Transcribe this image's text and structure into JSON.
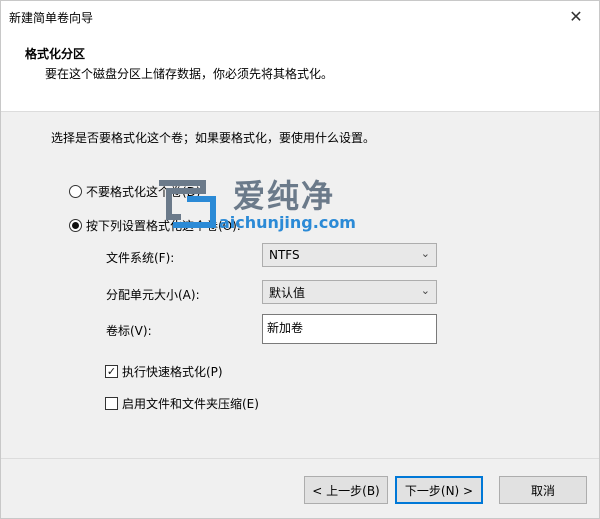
{
  "window": {
    "title": "新建简单卷向导",
    "close_symbol": "✕"
  },
  "header": {
    "title": "格式化分区",
    "subtitle": "要在这个磁盘分区上储存数据，你必须先将其格式化。"
  },
  "main": {
    "prompt": "选择是否要格式化这个卷；如果要格式化，要使用什么设置。",
    "options": [
      {
        "label": "不要格式化这个卷(D)",
        "checked": false
      },
      {
        "label": "按下列设置格式化这个卷(O):",
        "checked": true
      }
    ],
    "fields": {
      "filesystem": {
        "label": "文件系统(F):",
        "value": "NTFS"
      },
      "alloc_unit": {
        "label": "分配单元大小(A):",
        "value": "默认值"
      },
      "volume_label": {
        "label": "卷标(V):",
        "value": "新加卷"
      }
    },
    "checks": [
      {
        "label": "执行快速格式化(P)",
        "checked": true
      },
      {
        "label": "启用文件和文件夹压缩(E)",
        "checked": false
      }
    ]
  },
  "footer": {
    "back": "< 上一步(B)",
    "next": "下一步(N) >",
    "cancel": "取消"
  },
  "watermark": {
    "title": "爱纯净",
    "url": "aichunjing.com"
  },
  "icons": {
    "close": "close-icon",
    "dropdown": "chevron-down-icon",
    "check": "checkmark-icon",
    "logo": "watermark-logo-icon"
  },
  "colors": {
    "primary_border": "#0078d7",
    "watermark_gray": "#6b7a8a",
    "watermark_blue": "#2b8ad6"
  }
}
